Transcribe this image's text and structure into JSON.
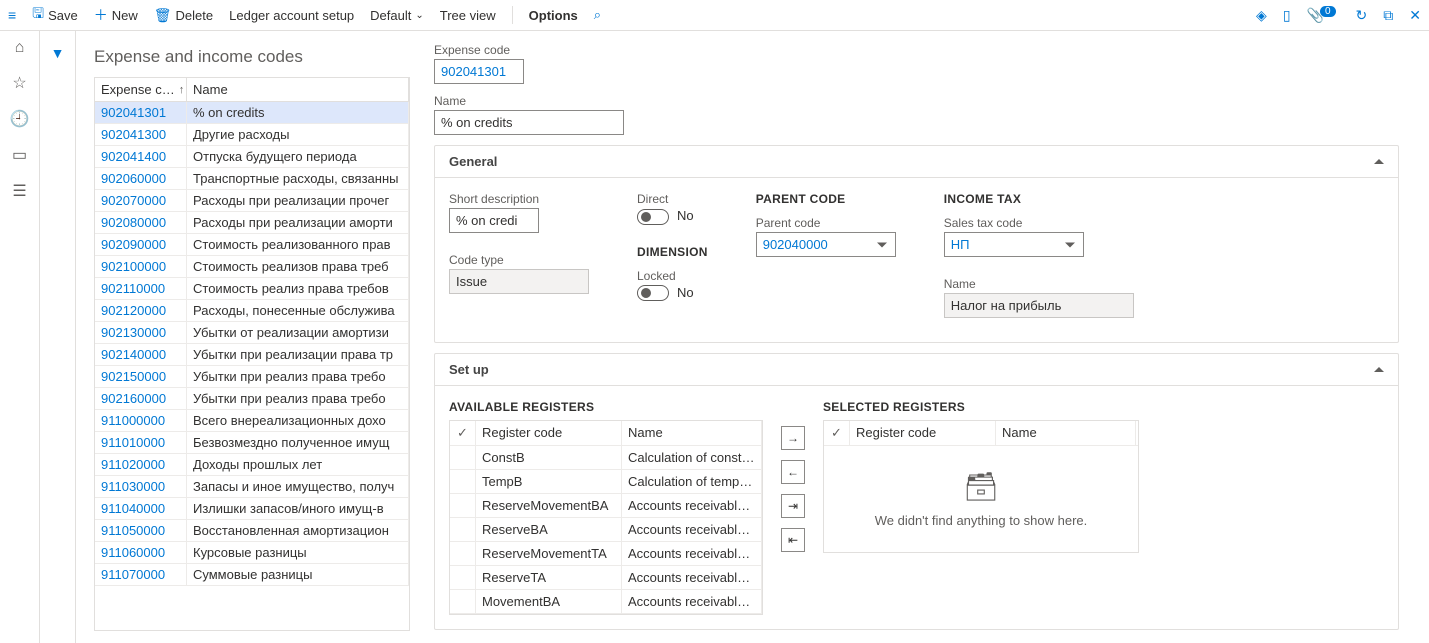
{
  "toolbar": {
    "save": "Save",
    "new": "New",
    "delete": "Delete",
    "ledger": "Ledger account setup",
    "default": "Default",
    "tree": "Tree view",
    "options": "Options",
    "badge": "0"
  },
  "page": {
    "title": "Expense and income codes"
  },
  "grid": {
    "col_code": "Expense c…",
    "col_name": "Name",
    "rows": [
      {
        "code": "902041301",
        "name": "% on credits"
      },
      {
        "code": "902041300",
        "name": "Другие расходы"
      },
      {
        "code": "902041400",
        "name": "Отпуска будущего периода"
      },
      {
        "code": "902060000",
        "name": "Транспортные расходы, связанны"
      },
      {
        "code": "902070000",
        "name": "Расходы при реализации прочег"
      },
      {
        "code": "902080000",
        "name": "Расходы при реализации аморти"
      },
      {
        "code": "902090000",
        "name": "Стоимость реализованного прав"
      },
      {
        "code": "902100000",
        "name": "Стоимость реализов права треб"
      },
      {
        "code": "902110000",
        "name": "Стоимость реализ права требов"
      },
      {
        "code": "902120000",
        "name": "Расходы, понесенные обслужива"
      },
      {
        "code": "902130000",
        "name": "Убытки от реализации амортизи"
      },
      {
        "code": "902140000",
        "name": "Убытки при реализации права тр"
      },
      {
        "code": "902150000",
        "name": "Убытки при реализ права требо"
      },
      {
        "code": "902160000",
        "name": "Убытки при реализ права требо"
      },
      {
        "code": "911000000",
        "name": "Всего внереализационных дохо"
      },
      {
        "code": "911010000",
        "name": "Безвозмездно полученное имущ"
      },
      {
        "code": "911020000",
        "name": "Доходы прошлых лет"
      },
      {
        "code": "911030000",
        "name": "Запасы и иное имущество, получ"
      },
      {
        "code": "911040000",
        "name": "Излишки запасов/иного имущ-в"
      },
      {
        "code": "911050000",
        "name": "Восстановленная амортизацион"
      },
      {
        "code": "911060000",
        "name": "Курсовые разницы"
      },
      {
        "code": "911070000",
        "name": "Суммовые разницы"
      }
    ]
  },
  "detail": {
    "expense_code_label": "Expense code",
    "expense_code": "902041301",
    "name_label": "Name",
    "name": "% on credits"
  },
  "general": {
    "title": "General",
    "short_desc_label": "Short description",
    "short_desc": "% on credi",
    "code_type_label": "Code type",
    "code_type": "Issue",
    "direct_label": "Direct",
    "direct_value": "No",
    "dimension_title": "DIMENSION",
    "locked_label": "Locked",
    "locked_value": "No",
    "parent_title": "PARENT CODE",
    "parent_label": "Parent code",
    "parent_value": "902040000",
    "income_title": "INCOME TAX",
    "salestax_label": "Sales tax code",
    "salestax_value": "НП",
    "tax_name_label": "Name",
    "tax_name_value": "Налог на прибыль"
  },
  "setup": {
    "title": "Set up",
    "available_title": "AVAILABLE REGISTERS",
    "selected_title": "SELECTED REGISTERS",
    "col_code": "Register code",
    "col_name": "Name",
    "available": [
      {
        "code": "ConstB",
        "name": "Calculation of consta…"
      },
      {
        "code": "TempB",
        "name": "Calculation of tempo…"
      },
      {
        "code": "ReserveMovementBA",
        "name": "Accounts receivable …"
      },
      {
        "code": "ReserveBA",
        "name": "Accounts receivable …"
      },
      {
        "code": "ReserveMovementTA",
        "name": "Accounts receivable …"
      },
      {
        "code": "ReserveTA",
        "name": "Accounts receivable …"
      },
      {
        "code": "MovementBA",
        "name": "Accounts receivable …"
      }
    ],
    "empty_msg": "We didn't find anything to show here."
  }
}
